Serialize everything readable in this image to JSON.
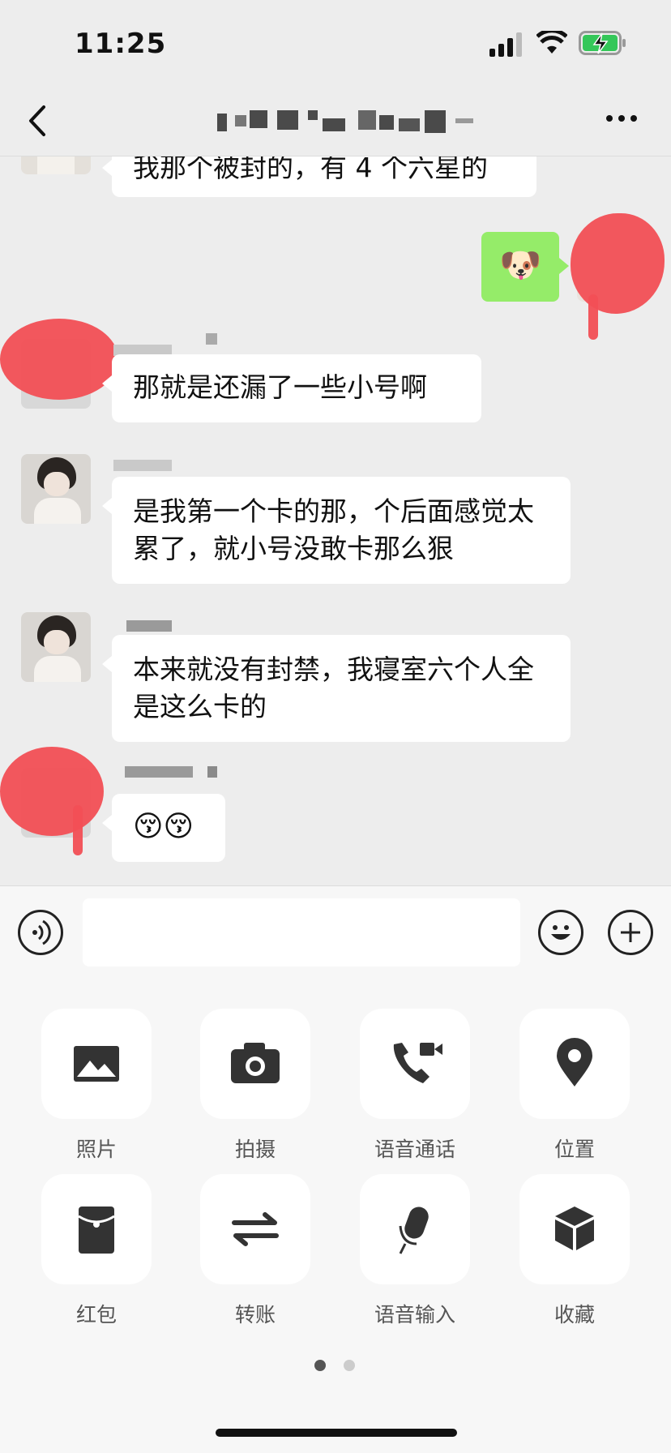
{
  "status": {
    "time": "11:25"
  },
  "messages": {
    "m1": "我那个被封的，有 4 个六星的",
    "m3": "那就是还漏了一些小号啊",
    "m4": "是我第一个卡的那，个后面感觉太累了，就小号没敢卡那么狠",
    "m5": "本来就没有封禁，我寝室六个人全是这么卡的",
    "m6": "😚😚",
    "sticker": "🐶"
  },
  "panel": {
    "items": [
      {
        "label": "照片",
        "icon": "photo-icon"
      },
      {
        "label": "拍摄",
        "icon": "camera-icon"
      },
      {
        "label": "语音通话",
        "icon": "voice-call-icon"
      },
      {
        "label": "位置",
        "icon": "location-icon"
      },
      {
        "label": "红包",
        "icon": "red-packet-icon"
      },
      {
        "label": "转账",
        "icon": "transfer-icon"
      },
      {
        "label": "语音输入",
        "icon": "microphone-icon"
      },
      {
        "label": "收藏",
        "icon": "favorites-icon"
      }
    ],
    "page_indicator": {
      "current": 1,
      "total": 2
    }
  },
  "colors": {
    "self_bubble": "#95ec69",
    "background": "#ededed",
    "scribble": "#f24f55"
  }
}
